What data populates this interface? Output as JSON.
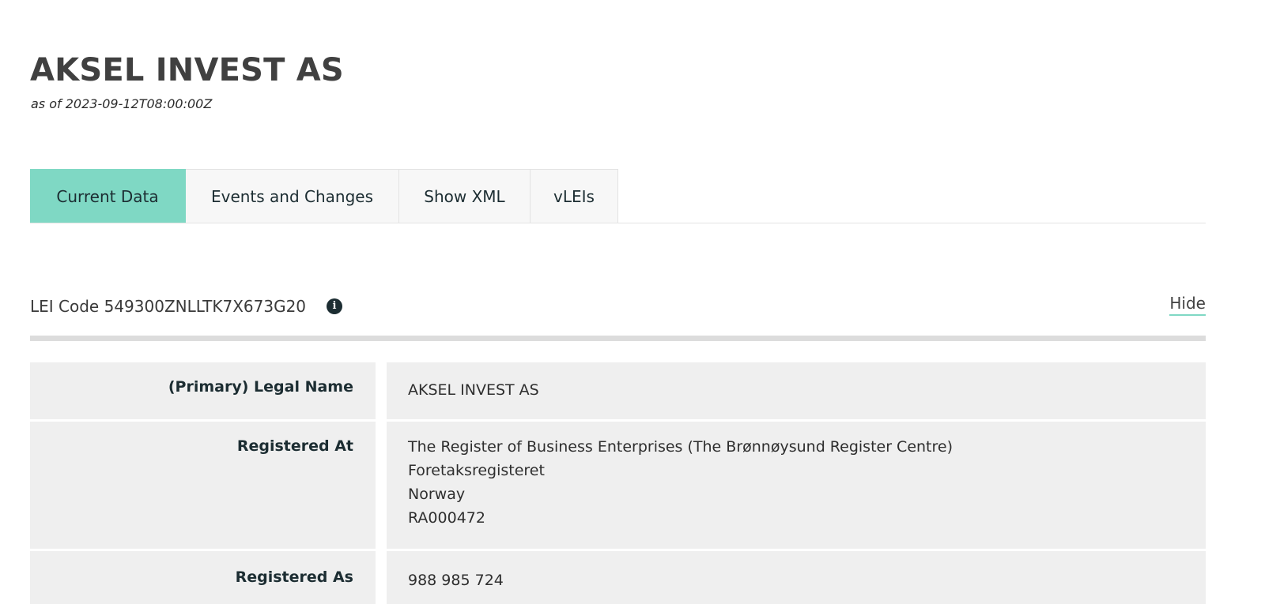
{
  "entity": {
    "title": "AKSEL INVEST AS",
    "as_of": "as of 2023-09-12T08:00:00Z"
  },
  "tabs": [
    {
      "label": "Current Data",
      "active": true
    },
    {
      "label": "Events and Changes",
      "active": false
    },
    {
      "label": "Show XML",
      "active": false
    },
    {
      "label": "vLEIs",
      "active": false
    }
  ],
  "lei": {
    "label": "LEI Code 549300ZNLLTK7X673G20",
    "info_icon": "info-icon",
    "hide_label": "Hide"
  },
  "fields": [
    {
      "label": "(Primary) Legal Name",
      "value_lines": [
        "AKSEL INVEST AS"
      ]
    },
    {
      "label": "Registered At",
      "value_lines": [
        "The Register of Business Enterprises (The Brønnøysund Register Centre)",
        "Foretaksregisteret",
        "Norway",
        "RA000472"
      ]
    },
    {
      "label": "Registered As",
      "value_lines": [
        "988 985 724"
      ]
    }
  ],
  "colors": {
    "accent": "#7fd8c4",
    "cell_bg": "#efefef",
    "dark_text": "#1c2d32"
  }
}
